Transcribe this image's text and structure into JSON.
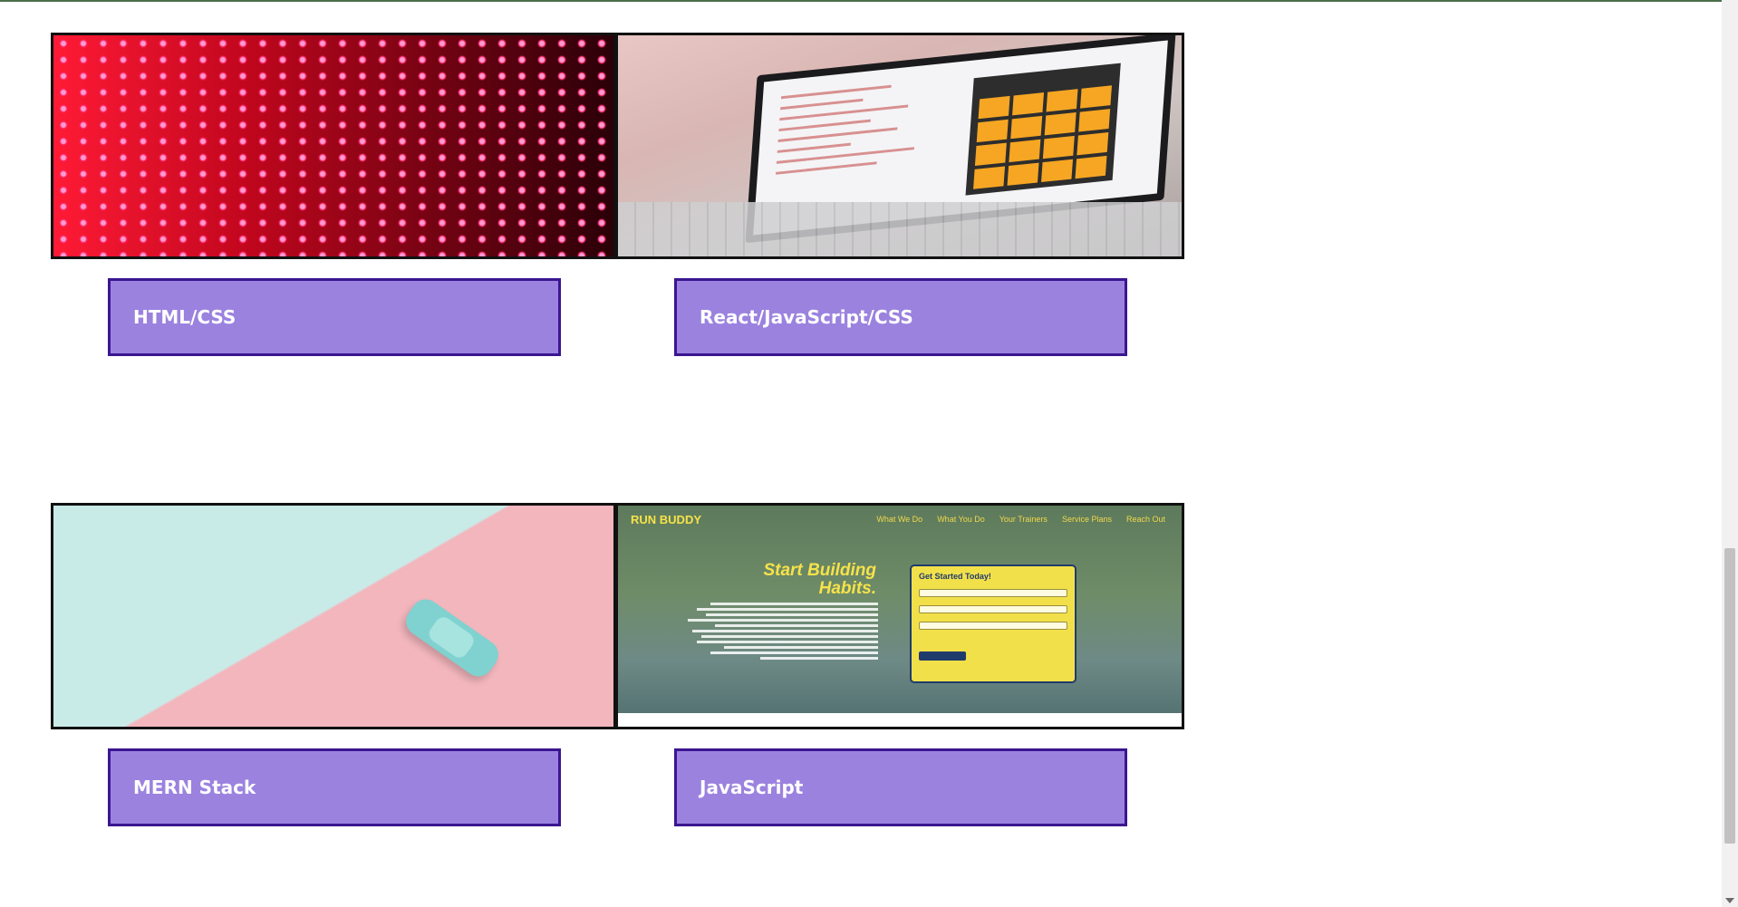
{
  "projects": [
    {
      "label": "HTML/CSS",
      "image": "red-led-wall-thumbnail"
    },
    {
      "label": "React/JavaScript/CSS",
      "image": "laptop-calculator-thumbnail"
    },
    {
      "label": "MERN Stack",
      "image": "toy-car-pastel-thumbnail"
    },
    {
      "label": "JavaScript",
      "image": "run-buddy-site-thumbnail"
    }
  ],
  "run_buddy_preview": {
    "brand": "RUN BUDDY",
    "nav": [
      "What We Do",
      "What You Do",
      "Your Trainers",
      "Service Plans",
      "Reach Out"
    ],
    "headline_line1": "Start Building",
    "headline_line2": "Habits.",
    "form_title": "Get Started Today!"
  },
  "colors": {
    "label_background": "#9b82df",
    "label_border": "#3a1690",
    "label_text": "#ffffff",
    "image_border": "#111111"
  }
}
